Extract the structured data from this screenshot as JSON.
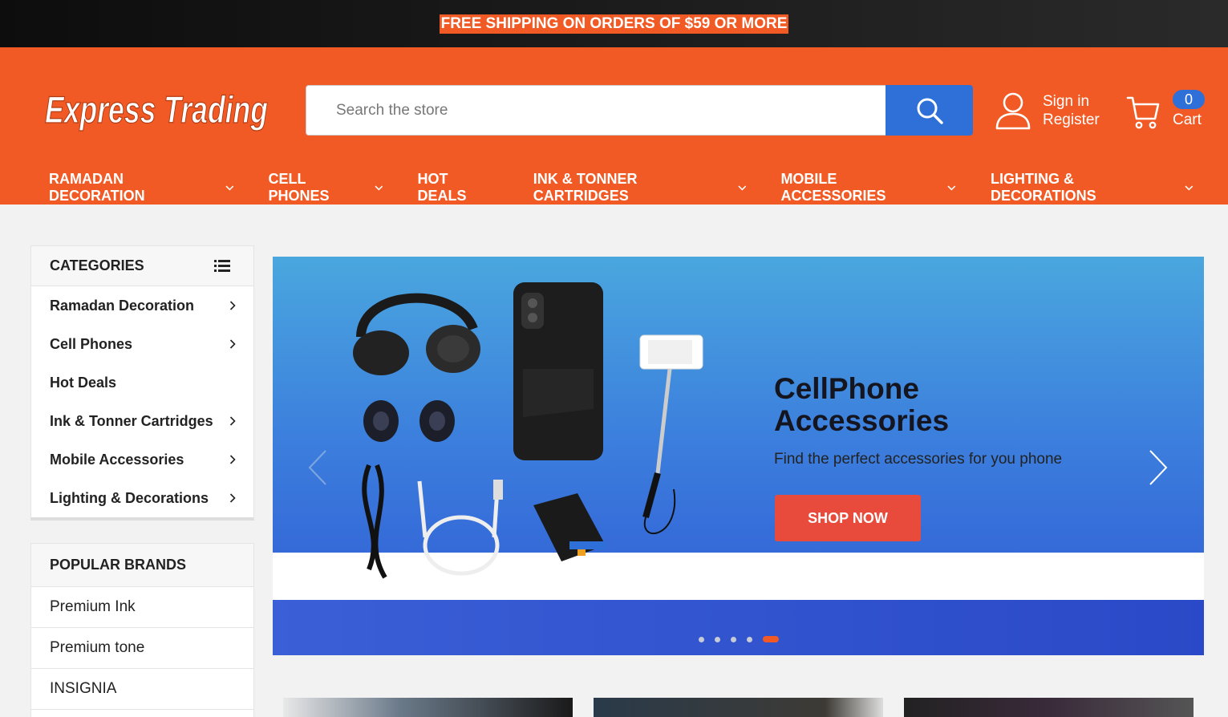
{
  "topbar": {
    "text": "FREE SHIPPING ON ORDERS OF $59 OR MORE"
  },
  "header": {
    "logo_text": "Express Trading",
    "search": {
      "placeholder": "Search the store",
      "value": ""
    },
    "account": {
      "sign_in": "Sign in",
      "register": "Register"
    },
    "cart": {
      "label": "Cart",
      "count": "0"
    }
  },
  "nav": {
    "items": [
      {
        "label": "RAMADAN DECORATION",
        "dropdown": true
      },
      {
        "label": "CELL PHONES",
        "dropdown": true
      },
      {
        "label": "HOT DEALS",
        "dropdown": false
      },
      {
        "label": "INK & TONNER CARTRIDGES",
        "dropdown": true
      },
      {
        "label": "MOBILE ACCESSORIES",
        "dropdown": true
      },
      {
        "label": "LIGHTING & DECORATIONS",
        "dropdown": true
      }
    ]
  },
  "categories": {
    "title": "CATEGORIES",
    "items": [
      {
        "label": "Ramadan Decoration",
        "has_children": true
      },
      {
        "label": "Cell Phones",
        "has_children": true
      },
      {
        "label": "Hot Deals",
        "has_children": false
      },
      {
        "label": "Ink & Tonner Cartridges",
        "has_children": true
      },
      {
        "label": "Mobile Accessories",
        "has_children": true
      },
      {
        "label": "Lighting & Decorations",
        "has_children": true
      }
    ]
  },
  "brands": {
    "title": "POPULAR BRANDS",
    "items": [
      "Premium Ink",
      "Premium tone",
      "INSIGNIA"
    ]
  },
  "hero": {
    "title_line1": "CellPhone",
    "title_line2": "Accessories",
    "subtitle": "Find the perfect accessories for you phone",
    "button": "SHOP NOW",
    "slides_count": 5,
    "active_slide": 5
  },
  "colors": {
    "brand_orange": "#f15a24",
    "accent_blue": "#2f6fd8",
    "cta_red": "#e84b3c"
  }
}
